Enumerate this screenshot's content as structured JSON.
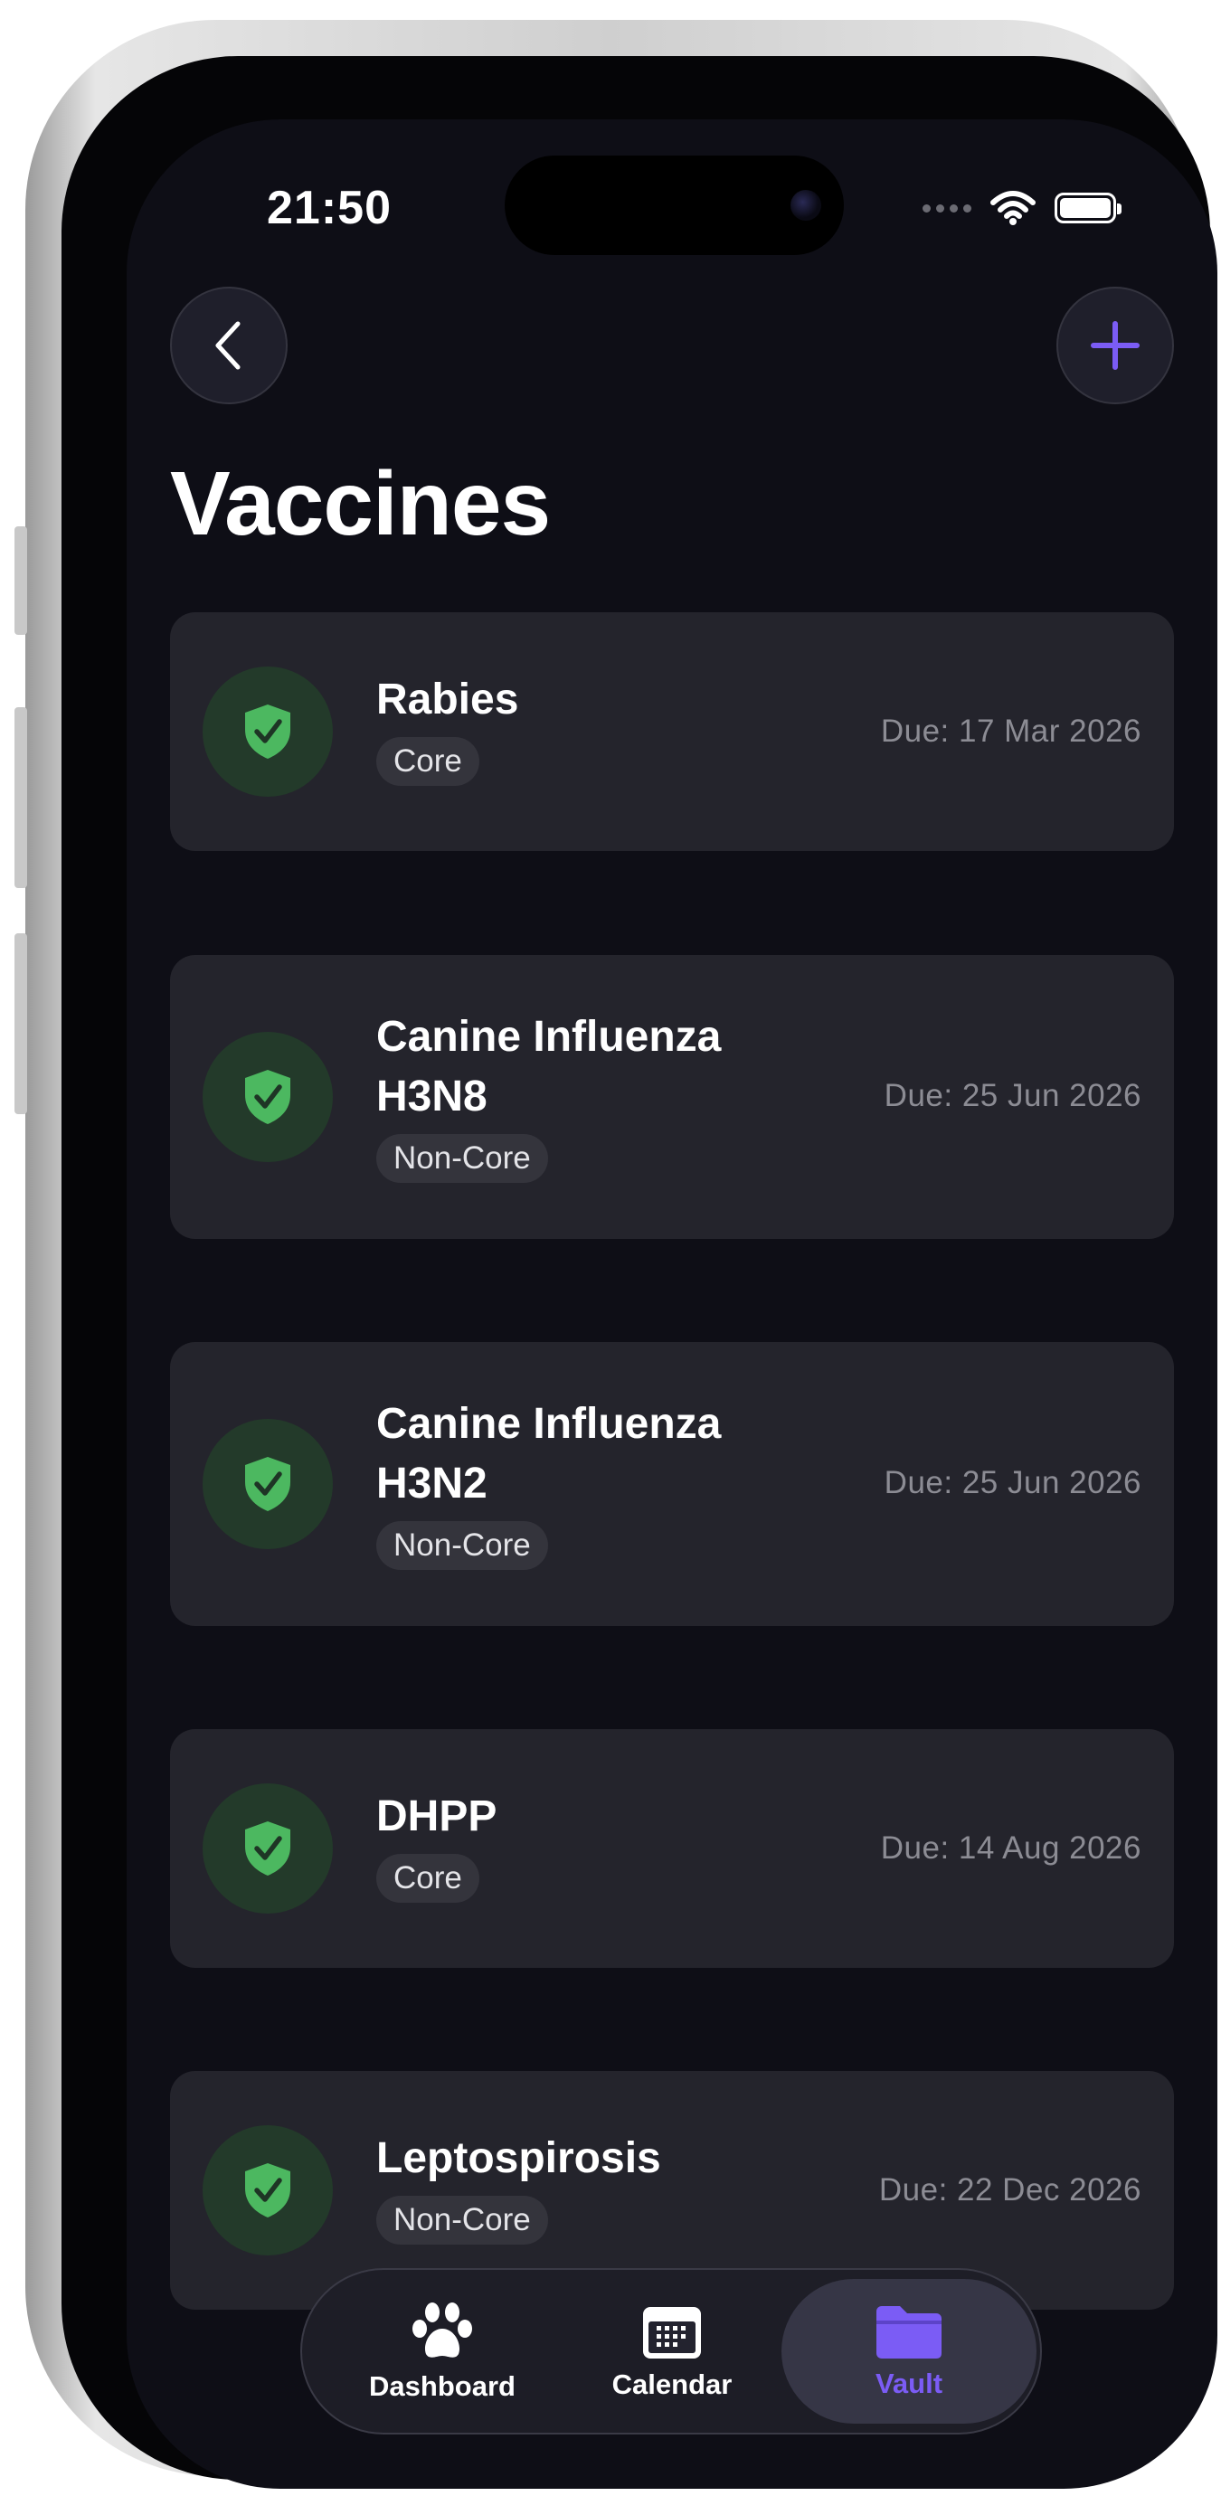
{
  "status_bar": {
    "time": "21:50"
  },
  "header": {
    "back_icon": "chevron-left-icon",
    "add_icon": "plus-icon",
    "title": "Vaccines"
  },
  "colors": {
    "accent": "#7b5cf5",
    "shield": "#4cb860",
    "background": "#0e0e16",
    "card": "#24242c"
  },
  "vaccines": [
    {
      "name": "Rabies",
      "type": "Core",
      "due": "Due: 17 Mar 2026"
    },
    {
      "name": "Canine Influenza H3N8",
      "type": "Non-Core",
      "due": "Due: 25 Jun 2026"
    },
    {
      "name": "Canine Influenza H3N2",
      "type": "Non-Core",
      "due": "Due: 25 Jun 2026"
    },
    {
      "name": "DHPP",
      "type": "Core",
      "due": "Due: 14 Aug 2026"
    },
    {
      "name": "Leptospirosis",
      "type": "Non-Core",
      "due": "Due: 22 Dec 2026"
    }
  ],
  "tabbar": {
    "items": [
      {
        "label": "Dashboard",
        "icon": "paw-icon"
      },
      {
        "label": "Calendar",
        "icon": "calendar-icon"
      },
      {
        "label": "Vault",
        "icon": "folder-icon",
        "active": true
      }
    ]
  }
}
